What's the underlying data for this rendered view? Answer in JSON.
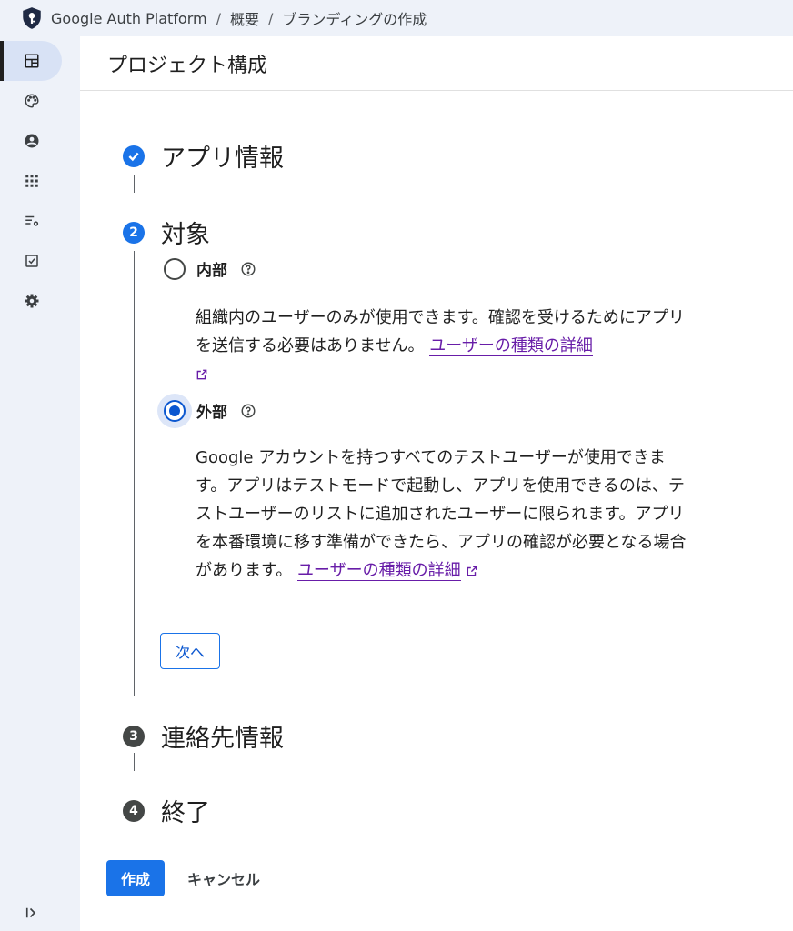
{
  "breadcrumb": {
    "app_name": "Google Auth Platform",
    "separator": "/",
    "overview": "概要",
    "current": "ブランディングの作成"
  },
  "sidebar": {
    "items": [
      {
        "name": "dashboard-icon",
        "active": true
      },
      {
        "name": "palette-icon",
        "active": false
      },
      {
        "name": "account-icon",
        "active": false
      },
      {
        "name": "apps-grid-icon",
        "active": false
      },
      {
        "name": "list-settings-icon",
        "active": false
      },
      {
        "name": "verification-icon",
        "active": false
      },
      {
        "name": "settings-icon",
        "active": false
      }
    ],
    "collapse_icon": "expand-panel-icon"
  },
  "main": {
    "header_title": "プロジェクト構成"
  },
  "steps": [
    {
      "number": "✓",
      "title": "アプリ情報",
      "state": "completed"
    },
    {
      "number": "2",
      "title": "対象",
      "state": "active"
    },
    {
      "number": "3",
      "title": "連絡先情報",
      "state": "pending"
    },
    {
      "number": "4",
      "title": "終了",
      "state": "pending"
    }
  ],
  "audience": {
    "internal": {
      "label": "内部",
      "selected": false,
      "description": "組織内のユーザーのみが使用できます。確認を受けるためにアプリを送信する必要はありません。",
      "link": "ユーザーの種類の詳細"
    },
    "external": {
      "label": "外部",
      "selected": true,
      "description": "Google アカウントを持つすべてのテストユーザーが使用できます。アプリはテストモードで起動し、アプリを使用できるのは、テストユーザーのリストに追加されたユーザーに限られます。アプリを本番環境に移す準備ができたら、アプリの確認が必要となる場合があります。",
      "link": "ユーザーの種類の詳細"
    },
    "next_button": "次へ"
  },
  "footer": {
    "create_button": "作成",
    "cancel_button": "キャンセル"
  },
  "colors": {
    "primary": "#1a73e8",
    "link": "#681da8",
    "sidebar_bg": "#eef2f9"
  }
}
